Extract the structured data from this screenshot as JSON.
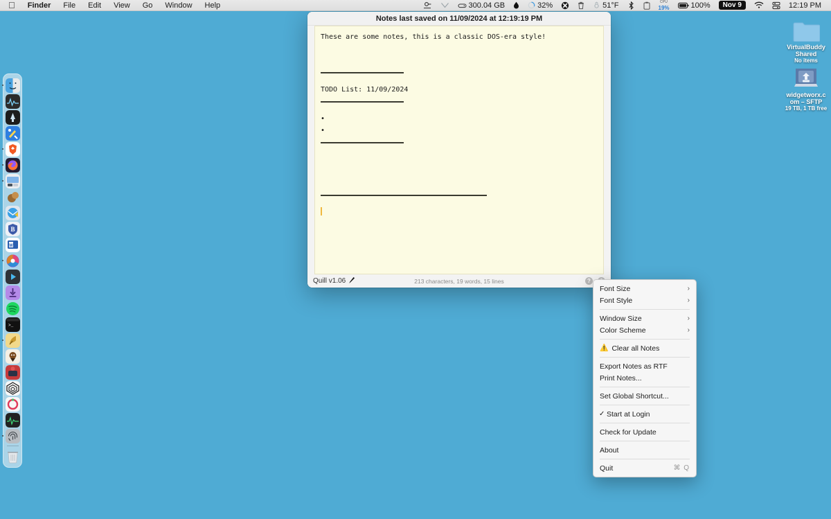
{
  "menubar": {
    "apple_icon": "apple-logo",
    "items": [
      {
        "label": "Finder",
        "bold": true
      },
      {
        "label": "File",
        "bold": false
      },
      {
        "label": "Edit",
        "bold": false
      },
      {
        "label": "View",
        "bold": false
      },
      {
        "label": "Go",
        "bold": false
      },
      {
        "label": "Window",
        "bold": false
      },
      {
        "label": "Help",
        "bold": false
      }
    ],
    "status": {
      "disk_space": "300.04 GB",
      "battery_circle": "32%",
      "temperature": "51°F",
      "cpu_label": "CPU",
      "cpu_value": "19%",
      "battery_percent": "100%",
      "date": "Nov 9",
      "time": "12:19 PM"
    }
  },
  "desktop": {
    "icons": [
      {
        "name": "VirtualBuddy",
        "line2": "Shared",
        "sub": "No items",
        "type": "folder"
      },
      {
        "name": "widgetworx.c",
        "line2": "om – SFTP",
        "sub": "19 TB, 1 TB free",
        "type": "drive"
      }
    ]
  },
  "dock": {
    "items": [
      {
        "name": "finder",
        "label": "Finder",
        "running": true
      },
      {
        "name": "activity-monitor",
        "label": "Activity Monitor",
        "running": false
      },
      {
        "name": "stats",
        "label": "Stats",
        "running": false
      },
      {
        "name": "utilities",
        "label": "Utilities",
        "running": false
      },
      {
        "name": "brave-browser",
        "label": "Brave",
        "running": true
      },
      {
        "name": "firefox",
        "label": "Firefox",
        "running": true
      },
      {
        "name": "screen-studio",
        "label": "Screen Studio",
        "running": true
      },
      {
        "name": "nut-store",
        "label": "Nut",
        "running": false
      },
      {
        "name": "mail-app",
        "label": "Mail",
        "running": false
      },
      {
        "name": "bitwarden",
        "label": "Bitwarden",
        "running": false
      },
      {
        "name": "notes-app",
        "label": "Notes",
        "running": false
      },
      {
        "name": "color-wheel",
        "label": "Color",
        "running": true
      },
      {
        "name": "media-player",
        "label": "Player",
        "running": false
      },
      {
        "name": "downloads-app",
        "label": "Downloads",
        "running": false
      },
      {
        "name": "spotify",
        "label": "Spotify",
        "running": false
      },
      {
        "name": "terminal",
        "label": "Terminal",
        "running": false
      },
      {
        "name": "quill",
        "label": "Quill",
        "running": true
      },
      {
        "name": "sketch-app",
        "label": "Sketch",
        "running": false
      },
      {
        "name": "gaming-app",
        "label": "Game",
        "running": false
      },
      {
        "name": "maze-app",
        "label": "Maze",
        "running": false
      },
      {
        "name": "ring-app",
        "label": "Ring",
        "running": false
      },
      {
        "name": "monitor-app",
        "label": "Monitor",
        "running": false
      },
      {
        "name": "fingerprint-app",
        "label": "Fingerprint",
        "running": true
      },
      {
        "name": "trash",
        "label": "Trash",
        "running": false
      }
    ]
  },
  "notes_window": {
    "title": "Notes last saved on 11/09/2024 at 12:19:19 PM",
    "content_lines": [
      {
        "type": "text",
        "value": "These are some notes, this is a classic DOS-era style!"
      },
      {
        "type": "blank",
        "value": ""
      },
      {
        "type": "blank",
        "value": ""
      },
      {
        "type": "rule-short",
        "value": ""
      },
      {
        "type": "text",
        "value": "TODO List: 11/09/2024"
      },
      {
        "type": "rule-short",
        "value": ""
      },
      {
        "type": "text",
        "value": "•"
      },
      {
        "type": "text",
        "value": "•"
      },
      {
        "type": "rule-short",
        "value": ""
      },
      {
        "type": "blank",
        "value": ""
      },
      {
        "type": "blank",
        "value": ""
      },
      {
        "type": "blank",
        "value": ""
      },
      {
        "type": "rule-long",
        "value": ""
      },
      {
        "type": "caret",
        "value": ""
      }
    ],
    "status": {
      "app_name": "Quill v1.06",
      "pencil_icon": "pencil-icon",
      "stats": "213 characters, 19 words, 15 lines",
      "help_icon": "help-circle-icon",
      "settings_icon": "settings-circle-icon"
    }
  },
  "context_menu": {
    "items": [
      {
        "label": "Font Size",
        "submenu": true,
        "checked": false,
        "shortcut": "",
        "warn": false,
        "sep_after": false
      },
      {
        "label": "Font Style",
        "submenu": true,
        "checked": false,
        "shortcut": "",
        "warn": false,
        "sep_after": true
      },
      {
        "label": "Window Size",
        "submenu": true,
        "checked": false,
        "shortcut": "",
        "warn": false,
        "sep_after": false
      },
      {
        "label": "Color Scheme",
        "submenu": true,
        "checked": false,
        "shortcut": "",
        "warn": false,
        "sep_after": true
      },
      {
        "label": "Clear all Notes",
        "submenu": false,
        "checked": false,
        "shortcut": "",
        "warn": true,
        "sep_after": true
      },
      {
        "label": "Export Notes as RTF",
        "submenu": false,
        "checked": false,
        "shortcut": "",
        "warn": false,
        "sep_after": false
      },
      {
        "label": "Print Notes...",
        "submenu": false,
        "checked": false,
        "shortcut": "",
        "warn": false,
        "sep_after": true
      },
      {
        "label": "Set Global Shortcut...",
        "submenu": false,
        "checked": false,
        "shortcut": "",
        "warn": false,
        "sep_after": true
      },
      {
        "label": "Start at Login",
        "submenu": false,
        "checked": true,
        "shortcut": "",
        "warn": false,
        "sep_after": true
      },
      {
        "label": "Check for Update",
        "submenu": false,
        "checked": false,
        "shortcut": "",
        "warn": false,
        "sep_after": true
      },
      {
        "label": "About",
        "submenu": false,
        "checked": false,
        "shortcut": "",
        "warn": false,
        "sep_after": true
      },
      {
        "label": "Quit",
        "submenu": false,
        "checked": false,
        "shortcut": "⌘ Q",
        "warn": false,
        "sep_after": false
      }
    ]
  },
  "colors": {
    "desktop": "#4fabd4",
    "note_paper": "#fcfbe3",
    "caret": "#f0b840",
    "menubar": "#e9e9e9"
  }
}
